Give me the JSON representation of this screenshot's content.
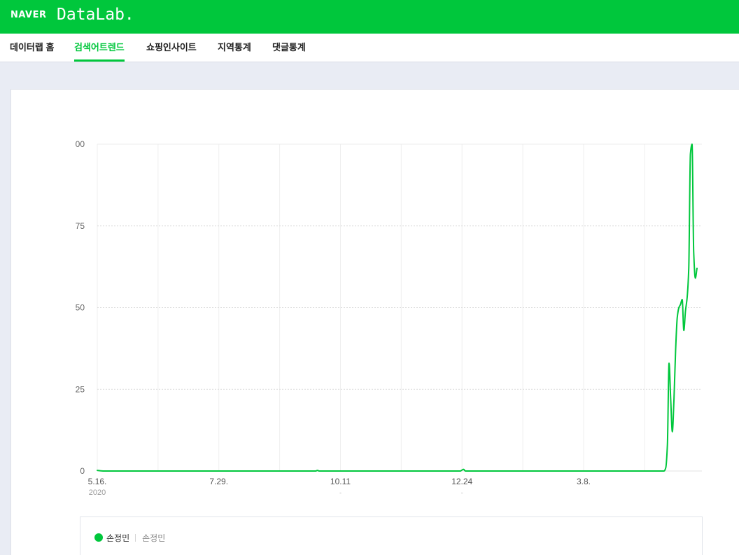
{
  "header": {
    "logo": "NAVER",
    "product": "DataLab."
  },
  "nav": {
    "items": [
      {
        "label": "데이터랩 홈",
        "active": false
      },
      {
        "label": "검색어트렌드",
        "active": true
      },
      {
        "label": "쇼핑인사이트",
        "active": false
      },
      {
        "label": "지역통계",
        "active": false
      },
      {
        "label": "댓글통계",
        "active": false
      }
    ]
  },
  "colors": {
    "brand": "#00c73c",
    "page_background": "#e9ecf4"
  },
  "legend": {
    "items": [
      {
        "keywords": "손정민"
      }
    ]
  },
  "chart_data": {
    "type": "line",
    "title": "",
    "xlabel": "",
    "ylabel": "",
    "x_type": "date",
    "xlim": [
      "2020-05-16",
      "2021-05-19"
    ],
    "ylim": [
      0,
      100
    ],
    "grid": true,
    "legend": "bottom",
    "yticks": [
      {
        "value": 0,
        "label": "0"
      },
      {
        "value": 25,
        "label": "25"
      },
      {
        "value": 50,
        "label": "50"
      },
      {
        "value": 75,
        "label": "75"
      },
      {
        "value": 100,
        "label": "00"
      }
    ],
    "xticks": [
      {
        "x": "2020-05-16",
        "label": "5.16.",
        "sublabel": "2020"
      },
      {
        "x": "2020-07-29",
        "label": "7.29.",
        "sublabel": ""
      },
      {
        "x": "2020-10-11",
        "label": "10.11",
        "sublabel": "-"
      },
      {
        "x": "2020-12-24",
        "label": "12.24",
        "sublabel": "-"
      },
      {
        "x": "2021-03-08",
        "label": "3.8.",
        "sublabel": ""
      }
    ],
    "series": [
      {
        "name": "손정민",
        "color": "#00c73c",
        "points": [
          {
            "x": "2020-05-16",
            "y": 0.2
          },
          {
            "x": "2020-05-20",
            "y": 0
          },
          {
            "x": "2020-06-22",
            "y": 0
          },
          {
            "x": "2020-07-29",
            "y": 0
          },
          {
            "x": "2020-08-30",
            "y": 0
          },
          {
            "x": "2020-09-26",
            "y": 0
          },
          {
            "x": "2020-09-27",
            "y": 0.2
          },
          {
            "x": "2020-09-28",
            "y": 0
          },
          {
            "x": "2020-10-11",
            "y": 0
          },
          {
            "x": "2020-11-17",
            "y": 0
          },
          {
            "x": "2020-12-23",
            "y": 0
          },
          {
            "x": "2020-12-24",
            "y": 0.3
          },
          {
            "x": "2020-12-25",
            "y": 0.5
          },
          {
            "x": "2020-12-26",
            "y": 0
          },
          {
            "x": "2021-01-30",
            "y": 0
          },
          {
            "x": "2021-03-08",
            "y": 0
          },
          {
            "x": "2021-04-14",
            "y": 0
          },
          {
            "x": "2021-04-26",
            "y": 0
          },
          {
            "x": "2021-04-27",
            "y": 1
          },
          {
            "x": "2021-04-28",
            "y": 8
          },
          {
            "x": "2021-04-29",
            "y": 33
          },
          {
            "x": "2021-04-30",
            "y": 22
          },
          {
            "x": "2021-05-01",
            "y": 12
          },
          {
            "x": "2021-05-02",
            "y": 22
          },
          {
            "x": "2021-05-03",
            "y": 37
          },
          {
            "x": "2021-05-04",
            "y": 47
          },
          {
            "x": "2021-05-05",
            "y": 50
          },
          {
            "x": "2021-05-06",
            "y": 51
          },
          {
            "x": "2021-05-07",
            "y": 52.5
          },
          {
            "x": "2021-05-08",
            "y": 43
          },
          {
            "x": "2021-05-09",
            "y": 49
          },
          {
            "x": "2021-05-10",
            "y": 53
          },
          {
            "x": "2021-05-11",
            "y": 62
          },
          {
            "x": "2021-05-12",
            "y": 97
          },
          {
            "x": "2021-05-13",
            "y": 100
          },
          {
            "x": "2021-05-14",
            "y": 67
          },
          {
            "x": "2021-05-15",
            "y": 59
          },
          {
            "x": "2021-05-16",
            "y": 62
          }
        ]
      }
    ]
  }
}
